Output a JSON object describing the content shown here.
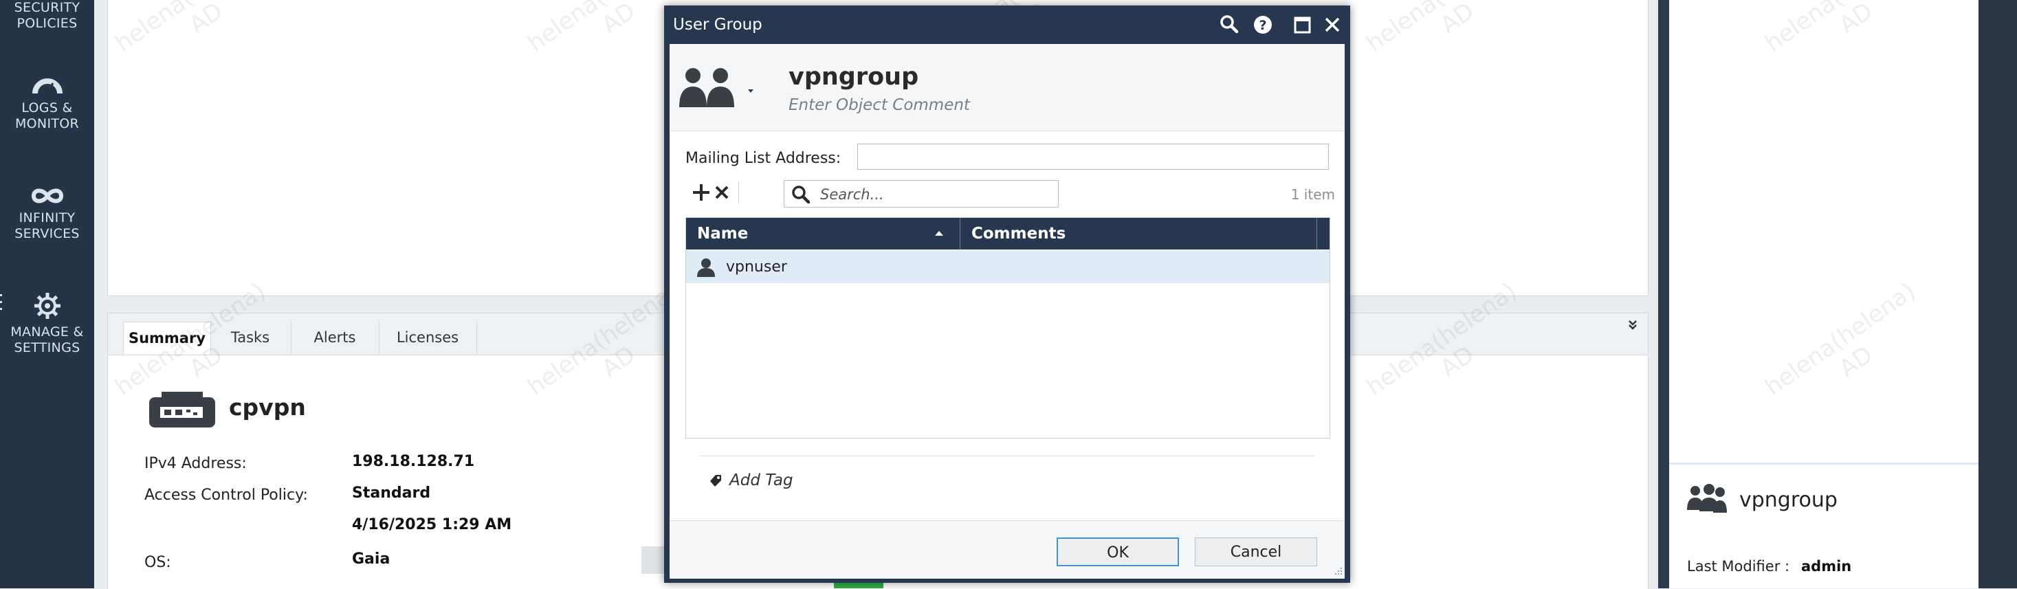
{
  "left_nav": {
    "items": [
      {
        "id": "security-policies",
        "label": "SECURITY\nPOLICIES",
        "icon": "shield-icon"
      },
      {
        "id": "logs-monitor",
        "label": "LOGS &\nMONITOR",
        "icon": "gauge-icon"
      },
      {
        "id": "infinity-services",
        "label": "INFINITY\nSERVICES",
        "icon": "infinity-icon"
      },
      {
        "id": "manage-settings",
        "label": "MANAGE &\nSETTINGS",
        "icon": "gear-icon"
      }
    ]
  },
  "summary_panel": {
    "tabs": [
      "Summary",
      "Tasks",
      "Alerts",
      "Licenses"
    ],
    "active_tab": "Summary",
    "gateway_name": "cpvpn",
    "properties": [
      {
        "label": "IPv4 Address:",
        "value": "198.18.128.71"
      },
      {
        "label": "Access Control Policy:",
        "value": "Standard"
      },
      {
        "label": "",
        "value": "4/16/2025 1:29 AM"
      },
      {
        "label": "OS:",
        "value": "Gaia"
      }
    ]
  },
  "dialog": {
    "title": "User Group",
    "controls": [
      "search-icon",
      "help-icon",
      "maximize-icon",
      "close-icon"
    ],
    "object_name": "vpngroup",
    "comment_placeholder": "Enter Object Comment",
    "mailing_list_label": "Mailing List Address:",
    "mailing_list_value": "",
    "search_placeholder": "Search...",
    "item_count": "1 item",
    "columns": {
      "name": "Name",
      "comments": "Comments"
    },
    "members": [
      {
        "name": "vpnuser",
        "comments": "",
        "icon": "user-icon"
      }
    ],
    "add_tag_label": "Add Tag",
    "ok_label": "OK",
    "cancel_label": "Cancel"
  },
  "right_panel": {
    "object_name": "vpngroup",
    "last_modifier_label": "Last Modifier :",
    "last_modifier_value": "admin"
  },
  "watermark_text": "helena(helena)\nAD",
  "colors": {
    "nav_bg": "#253446",
    "dialog_frame": "#273750",
    "grid_header": "#273750",
    "selected_row": "#dfebf6",
    "ok_focus": "#4a90d9"
  }
}
